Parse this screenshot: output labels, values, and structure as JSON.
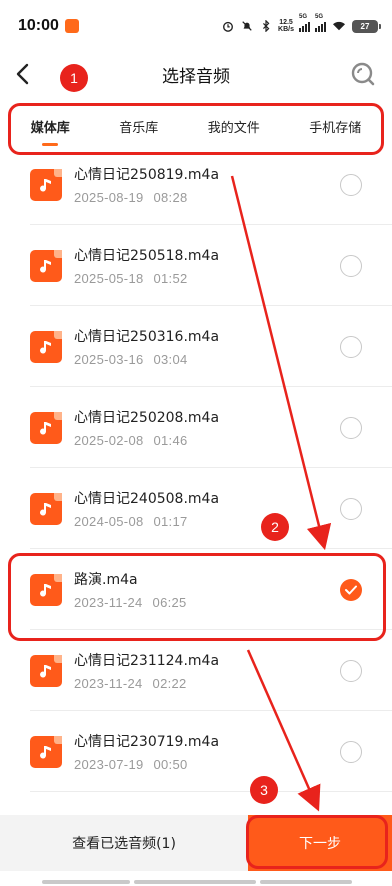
{
  "status_bar": {
    "time": "10:00",
    "net_speed_value": "12.5",
    "net_speed_unit": "KB/s",
    "signal1_label": "5G",
    "signal2_label": "5G",
    "battery": "27"
  },
  "header": {
    "title": "选择音频"
  },
  "tabs": [
    {
      "label": "媒体库",
      "active": true
    },
    {
      "label": "音乐库",
      "active": false
    },
    {
      "label": "我的文件",
      "active": false
    },
    {
      "label": "手机存储",
      "active": false
    }
  ],
  "files": [
    {
      "name": "心情日记250819.m4a",
      "date": "2025-08-19",
      "time": "08:28",
      "selected": false
    },
    {
      "name": "心情日记250518.m4a",
      "date": "2025-05-18",
      "time": "01:52",
      "selected": false
    },
    {
      "name": "心情日记250316.m4a",
      "date": "2025-03-16",
      "time": "03:04",
      "selected": false
    },
    {
      "name": "心情日记250208.m4a",
      "date": "2025-02-08",
      "time": "01:46",
      "selected": false
    },
    {
      "name": "心情日记240508.m4a",
      "date": "2024-05-08",
      "time": "01:17",
      "selected": false
    },
    {
      "name": "路演.m4a",
      "date": "2023-11-24",
      "time": "06:25",
      "selected": true
    },
    {
      "name": "心情日记231124.m4a",
      "date": "2023-11-24",
      "time": "02:22",
      "selected": false
    },
    {
      "name": "心情日记230719.m4a",
      "date": "2023-07-19",
      "time": "00:50",
      "selected": false
    }
  ],
  "bottom_bar": {
    "view_selected_label": "查看已选音频(1)",
    "next_label": "下一步"
  },
  "annotations": {
    "step1": "1",
    "step2": "2",
    "step3": "3",
    "color": "#e8231c"
  },
  "colors": {
    "accent": "#ff5a1a"
  }
}
